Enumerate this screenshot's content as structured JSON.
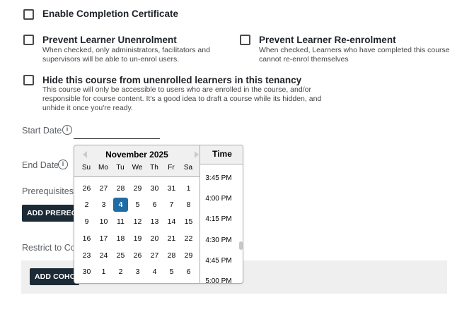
{
  "options": {
    "completion_certificate": {
      "title": "Enable Completion Certificate"
    },
    "prevent_unenrol": {
      "title": "Prevent Learner Unenrolment",
      "desc_1": "When checked, only administrators, facilitators and",
      "desc_2": "supervisors will be able to un-enrol users."
    },
    "prevent_reenrol": {
      "title": "Prevent Learner Re-enrolment",
      "desc_1": "When checked, Learners who have completed this course",
      "desc_2": "cannot re-enrol themselves"
    },
    "hide_course": {
      "title": "Hide this course from unenrolled learners in this tenancy",
      "desc_1": "This course will only be accessible to users who are enrolled in the course, and/or",
      "desc_2": "responsible for course content. It's a good idea to draft a course while its hidden, and",
      "desc_3": "unhide it once you're ready."
    }
  },
  "fields": {
    "start_date": {
      "label": "Start Date",
      "info": "i"
    },
    "end_date": {
      "label": "End Date",
      "info": "i"
    },
    "prerequisites": {
      "label": "Prerequisites",
      "button": "ADD PREREQUISITE"
    },
    "restrict_cohort": {
      "label": "Restrict to Cohort",
      "button": "ADD COHORT"
    }
  },
  "datepicker": {
    "month_label": "November 2025",
    "weekdays": [
      "Su",
      "Mo",
      "Tu",
      "We",
      "Th",
      "Fr",
      "Sa"
    ],
    "weeks": [
      [
        "26",
        "27",
        "28",
        "29",
        "30",
        "31",
        "1"
      ],
      [
        "2",
        "3",
        "4",
        "5",
        "6",
        "7",
        "8"
      ],
      [
        "9",
        "10",
        "11",
        "12",
        "13",
        "14",
        "15"
      ],
      [
        "16",
        "17",
        "18",
        "19",
        "20",
        "21",
        "22"
      ],
      [
        "23",
        "24",
        "25",
        "26",
        "27",
        "28",
        "29"
      ],
      [
        "30",
        "1",
        "2",
        "3",
        "4",
        "5",
        "6"
      ]
    ],
    "selected_day": "4",
    "time_header": "Time",
    "times": [
      "3:45 PM",
      "4:00 PM",
      "4:15 PM",
      "4:30 PM",
      "4:45 PM",
      "5:00 PM"
    ]
  },
  "colors": {
    "selected_day": "#216ba5",
    "button_bg": "#1b2a35"
  }
}
